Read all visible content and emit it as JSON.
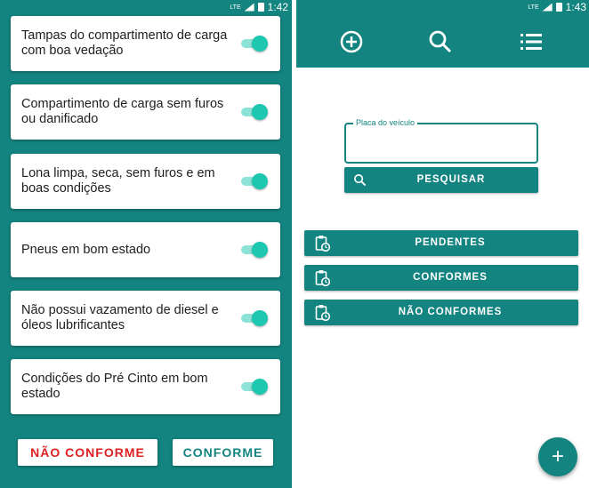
{
  "left_screen": {
    "status_bar": {
      "time": "1:42",
      "network": "LTE"
    },
    "checklist": [
      {
        "label": "Tampas do compartimento de carga com boa vedação",
        "checked": true
      },
      {
        "label": "Compartimento de carga sem furos ou danificado",
        "checked": true
      },
      {
        "label": "Lona limpa, seca, sem furos e em boas condições",
        "checked": true
      },
      {
        "label": "Pneus em bom estado",
        "checked": true
      },
      {
        "label": "Não possui vazamento de diesel e óleos lubrificantes",
        "checked": true
      },
      {
        "label": "Condições do Pré Cinto em bom estado",
        "checked": true
      }
    ],
    "actions": {
      "non_conform": "NÃO CONFORME",
      "conform": "CONFORME"
    }
  },
  "right_screen": {
    "status_bar": {
      "time": "1:43",
      "network": "LTE"
    },
    "toolbar": {
      "icons": [
        "add-circle-icon",
        "search-icon",
        "list-icon"
      ]
    },
    "plate_search": {
      "label": "Placa do veículo",
      "value": "",
      "button_label": "PESQUISAR"
    },
    "filters": [
      {
        "label": "PENDENTES",
        "icon": "clipboard-clock-icon"
      },
      {
        "label": "CONFORMES",
        "icon": "clipboard-clock-icon"
      },
      {
        "label": "NÃO CONFORMES",
        "icon": "clipboard-clock-icon"
      }
    ],
    "fab": {
      "icon": "plus-icon",
      "symbol": "+"
    }
  },
  "colors": {
    "primary": "#138480",
    "switch_thumb": "#1dc7b0",
    "switch_track": "#8ee3d8",
    "danger": "#e02020"
  }
}
